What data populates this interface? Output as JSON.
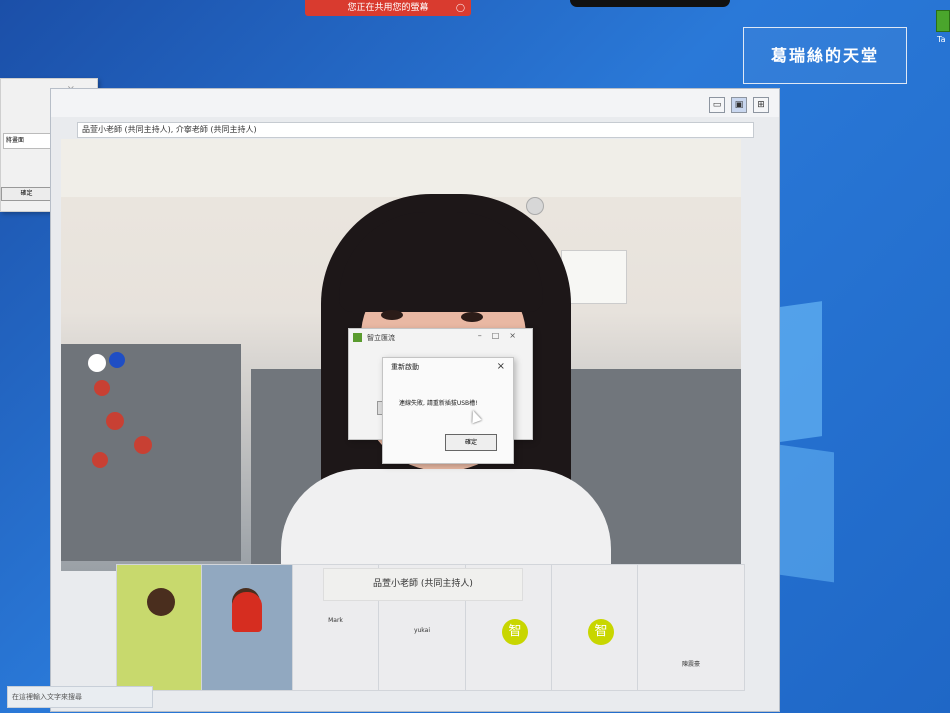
{
  "desktop": {
    "banner_text": "您正在共用您的螢幕",
    "banner_stop_icon": "stop-circle-icon",
    "watermark_text": "葛瑞絲的天堂",
    "desktop_icon_label": "Ta"
  },
  "left_panel": {
    "select_value": "將畫面",
    "ok_label": "確定"
  },
  "meeting": {
    "host_line": "品萱小老師 (共同主持人), 介寧老師 (共同主持人)",
    "view_icons": [
      "view-icon",
      "view-icon",
      "grid-icon"
    ]
  },
  "dialog_back": {
    "title": "智立匯流"
  },
  "dialog_front": {
    "title": "重新啟動",
    "message": "連線失敗, 請重新插拔USB槽!",
    "confirm_label": "確定"
  },
  "participants": [
    {
      "name": ""
    },
    {
      "name": ""
    },
    {
      "name": "Mark"
    },
    {
      "name": "yukai"
    },
    {
      "name": ""
    },
    {
      "name": ""
    },
    {
      "name": "陳震豪"
    }
  ],
  "name_banner": "品萱小老師 (共同主持人)",
  "taskbar": {
    "search_placeholder": "在這裡輸入文字來搜尋"
  }
}
